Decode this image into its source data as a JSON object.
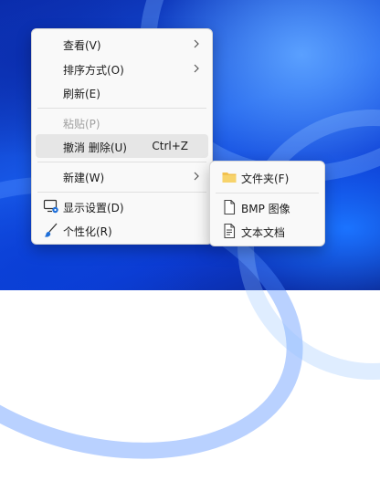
{
  "context_menu": {
    "items": [
      {
        "label": "查看(V)"
      },
      {
        "label": "排序方式(O)"
      },
      {
        "label": "刷新(E)"
      },
      {
        "label": "粘贴(P)"
      },
      {
        "label": "撤消 删除(U)",
        "shortcut": "Ctrl+Z"
      },
      {
        "label": "新建(W)"
      },
      {
        "label": "显示设置(D)"
      },
      {
        "label": "个性化(R)"
      }
    ]
  },
  "submenu_new": {
    "items": [
      {
        "label": "文件夹(F)"
      },
      {
        "label": "BMP 图像"
      },
      {
        "label": "文本文档"
      }
    ]
  },
  "colors": {
    "menu_bg": "#f9f9f9",
    "highlight": "#e6e6e6",
    "folder": "#f2c14e",
    "disabled_text": "#a0a0a0"
  }
}
